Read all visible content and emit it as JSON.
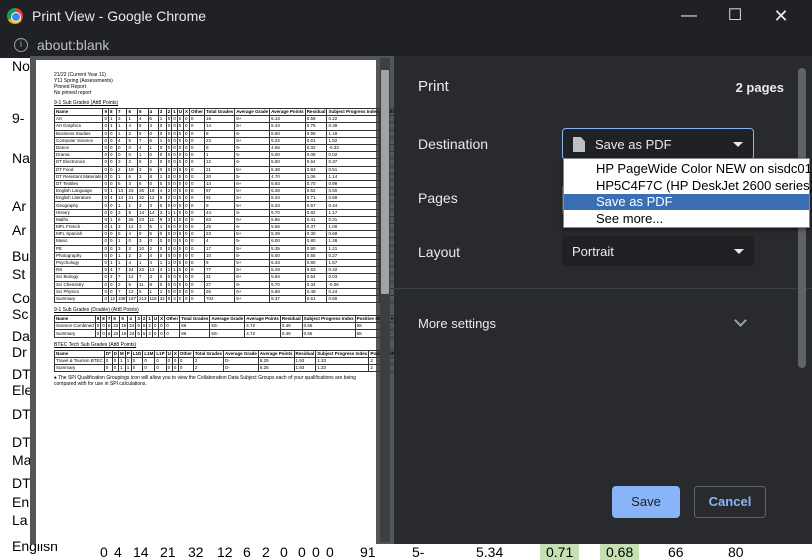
{
  "window": {
    "title": "Print View - Google Chrome",
    "url": "about:blank"
  },
  "background": {
    "lines": [
      "21",
      "Y1",
      "Pin",
      "No",
      "9-",
      "Na",
      "Ar",
      "Ar",
      "Bu",
      "St",
      "Co",
      "Sc",
      "Da",
      "Dr",
      "DT",
      "Ele",
      "DT",
      "DT",
      "Ma",
      "DT",
      "En",
      "La"
    ],
    "bottom_row": {
      "label": "English",
      "cells": [
        "0",
        "4",
        "14",
        "21",
        "32",
        "12",
        "6",
        "2",
        "0",
        "0",
        "0",
        "0",
        "91",
        "5-",
        "5.34",
        "0.71",
        "0.68",
        "66",
        "80"
      ]
    }
  },
  "print": {
    "title": "Print",
    "page_count": "2 pages",
    "destination_label": "Destination",
    "destination_value": "Save as PDF",
    "pages_label": "Pages",
    "layout_label": "Layout",
    "layout_value": "Portrait",
    "more_settings": "More settings",
    "save": "Save",
    "cancel": "Cancel"
  },
  "menu": {
    "items": [
      "HP PageWide Color NEW on sisdc01",
      "HP5C4F7C (HP DeskJet 2600 series)",
      "Save as PDF",
      "See more..."
    ],
    "selected_index": 2
  },
  "report": {
    "meta": [
      "21/22 (Current Year 11)",
      "Y11 Spring (Assessments)",
      "Pinned Report",
      "No pinned report"
    ],
    "table1": {
      "caption": "9-1 Sub Grades (Att8 Points)",
      "headers": [
        "Name",
        "9",
        "8",
        "7",
        "6",
        "5",
        "4",
        "3",
        "2",
        "1",
        "U",
        "X",
        "Other",
        "Total Grades",
        "Average Grade",
        "Average Points",
        "Residual",
        "Subject Progress Index",
        "Positive SPI",
        "In All Basket"
      ],
      "rows": [
        [
          "Art",
          "0",
          "1",
          "3",
          "1",
          "4",
          "6",
          "1",
          "0",
          "0",
          "0",
          "0",
          "0",
          "16",
          "5+",
          "5.13",
          "0.59",
          "0.22",
          "10",
          "15"
        ],
        [
          "Art Graphics",
          "0",
          "1",
          "1",
          "4",
          "5",
          "3",
          "0",
          "0",
          "0",
          "0",
          "0",
          "0",
          "14",
          "5+",
          "5.43",
          "0.75",
          "0.39",
          "11",
          "13"
        ],
        [
          "Business Studies",
          "0",
          "0",
          "1",
          "2",
          "5",
          "0",
          "0",
          "0",
          "0",
          "0",
          "0",
          "0",
          "8",
          "6-",
          "5.50",
          "0.95",
          "1.18",
          "6",
          "8"
        ],
        [
          "Computer Science",
          "0",
          "0",
          "4",
          "5",
          "7",
          "6",
          "1",
          "0",
          "0",
          "0",
          "0",
          "0",
          "23",
          "5+",
          "5.22",
          "0.61",
          "1.52",
          "20",
          "23"
        ],
        [
          "Dance",
          "0",
          "0",
          "0",
          "0",
          "4",
          "1",
          "0",
          "0",
          "0",
          "0",
          "0",
          "0",
          "9",
          "5-",
          "4.56",
          "0.32",
          "-0.33",
          "3",
          "8"
        ],
        [
          "Drama",
          "0",
          "0",
          "0",
          "0",
          "1",
          "0",
          "0",
          "0",
          "0",
          "0",
          "0",
          "0",
          "1",
          "5-",
          "5.00",
          "0.08",
          "0.02",
          "1",
          "1"
        ],
        [
          "DT Electronics",
          "0",
          "0",
          "3",
          "2",
          "5",
          "2",
          "0",
          "0",
          "0",
          "0",
          "0",
          "0",
          "12",
          "6-",
          "5.50",
          "0.64",
          "0.37",
          "6",
          "12"
        ],
        [
          "DT Food",
          "0",
          "0",
          "2",
          "10",
          "3",
          "6",
          "0",
          "0",
          "0",
          "0",
          "0",
          "0",
          "21",
          "5+",
          "5.38",
          "0.83",
          "0.51",
          "21",
          "21"
        ],
        [
          "DT Resistant Materials",
          "0",
          "0",
          "1",
          "6",
          "3",
          "8",
          "1",
          "0",
          "0",
          "0",
          "0",
          "0",
          "20",
          "5-",
          "4.70",
          "1.06",
          "1.14",
          "15",
          "20"
        ],
        [
          "DT Textiles",
          "0",
          "0",
          "5",
          "3",
          "6",
          "0",
          "0",
          "0",
          "0",
          "0",
          "0",
          "0",
          "14",
          "6+",
          "5.93",
          "0.70",
          "0.99",
          "12",
          "14"
        ],
        [
          "English Language",
          "0",
          "1",
          "13",
          "23",
          "26",
          "18",
          "4",
          "2",
          "0",
          "0",
          "0",
          "0",
          "87",
          "5+",
          "5.28",
          "0.62",
          "0.60",
          "60",
          "86"
        ],
        [
          "English Literature",
          "0",
          "4",
          "14",
          "21",
          "32",
          "12",
          "6",
          "2",
          "0",
          "0",
          "0",
          "0",
          "91",
          "5+",
          "5.34",
          "0.71",
          "0.68",
          "66",
          "89"
        ],
        [
          "Geography",
          "0",
          "0",
          "1",
          "1",
          "3",
          "3",
          "0",
          "0",
          "0",
          "0",
          "0",
          "0",
          "9",
          "5+",
          "5.33",
          "0.57",
          "0.44",
          "7",
          "9"
        ],
        [
          "History",
          "0",
          "0",
          "3",
          "8",
          "14",
          "14",
          "3",
          "1",
          "1",
          "0",
          "0",
          "0",
          "44",
          "5-",
          "5.70",
          "0.82",
          "1.17",
          "36",
          "44"
        ],
        [
          "Maths",
          "0",
          "1",
          "9",
          "26",
          "23",
          "11",
          "9",
          "3",
          "1",
          "0",
          "0",
          "0",
          "83",
          "5+",
          "5.86",
          "0.41",
          "0.31",
          "51",
          "83"
        ],
        [
          "MFL French",
          "0",
          "1",
          "3",
          "12",
          "3",
          "5",
          "1",
          "0",
          "0",
          "0",
          "0",
          "0",
          "25",
          "6-",
          "5.56",
          "0.37",
          "1.00",
          "20",
          "23"
        ],
        [
          "MFL Spanish",
          "0",
          "0",
          "5",
          "4",
          "9",
          "5",
          "0",
          "0",
          "0",
          "0",
          "0",
          "0",
          "23",
          "5+",
          "5.39",
          "0.30",
          "0.68",
          "17",
          "21"
        ],
        [
          "Music",
          "0",
          "0",
          "1",
          "0",
          "3",
          "0",
          "0",
          "0",
          "0",
          "0",
          "0",
          "0",
          "4",
          "5-",
          "6.00",
          "0.80",
          "1.48",
          "5",
          "5"
        ],
        [
          "PE",
          "0",
          "0",
          "3",
          "2",
          "10",
          "2",
          "0",
          "0",
          "0",
          "0",
          "0",
          "0",
          "17",
          "5+",
          "5.35",
          "0.90",
          "1.21",
          "16",
          "17"
        ],
        [
          "Photography",
          "0",
          "0",
          "1",
          "2",
          "3",
          "4",
          "0",
          "0",
          "0",
          "0",
          "0",
          "0",
          "10",
          "5-",
          "5.00",
          "0.55",
          "0.27",
          "5",
          "10"
        ],
        [
          "Psychology",
          "0",
          "1",
          "1",
          "4",
          "1",
          "4",
          "1",
          "1",
          "0",
          "0",
          "0",
          "0",
          "9",
          "5+",
          "5.33",
          "0.80",
          "1.57",
          "9",
          "8"
        ],
        [
          "RS",
          "0",
          "4",
          "7",
          "24",
          "23",
          "13",
          "4",
          "1",
          "1",
          "0",
          "0",
          "0",
          "77",
          "5+",
          "5.29",
          "0.63",
          "0.42",
          "43",
          "75"
        ],
        [
          "Sci Biology",
          "0",
          "2",
          "7",
          "12",
          "7",
          "3",
          "0",
          "0",
          "0",
          "0",
          "0",
          "0",
          "31",
          "6+",
          "5.94",
          "0.54",
          "0.03",
          "16",
          "31"
        ],
        [
          "Sci Chemistry",
          "0",
          "0",
          "2",
          "6",
          "11",
          "8",
          "0",
          "0",
          "0",
          "0",
          "0",
          "0",
          "27",
          "6-",
          "5.70",
          "0.34",
          "-0.06",
          "14",
          "27"
        ],
        [
          "Sci Physics",
          "0",
          "0",
          "7",
          "12",
          "5",
          "1",
          "1",
          "0",
          "0",
          "0",
          "0",
          "0",
          "26",
          "6+",
          "5.88",
          "0.49",
          "0.24",
          "14",
          "26"
        ],
        [
          "Summary",
          "0",
          "12",
          "108",
          "197",
          "213",
          "118",
          "32",
          "9",
          "3",
          "0",
          "0",
          "0",
          "702",
          "5+",
          "5.37",
          "0.61",
          "0.60",
          "475",
          "688"
        ]
      ]
    },
    "table2": {
      "caption": "9-1 Sub Grades (Double) (Att8 Points)",
      "headers": [
        "Name",
        "9",
        "8",
        "7",
        "6",
        "5",
        "4",
        "3",
        "2",
        "1",
        "U",
        "X",
        "Other",
        "Total Grades",
        "Average Grade",
        "Average Points",
        "Residual",
        "Subject Progress Index",
        "Positive SPI",
        "In All Basket"
      ],
      "rows": [
        [
          "Science Combined",
          "0",
          "0",
          "6",
          "22",
          "18",
          "24",
          "6",
          "6",
          "2",
          "0",
          "0",
          "0",
          "86",
          "5S-",
          "4.72",
          "0.49",
          "0.66",
          "58",
          "86"
        ],
        [
          "Summary",
          "0",
          "0",
          "6",
          "22",
          "18",
          "24",
          "6",
          "6",
          "2",
          "0",
          "0",
          "0",
          "86",
          "5S-",
          "4.72",
          "0.49",
          "0.66",
          "58",
          "86"
        ]
      ]
    },
    "table3": {
      "caption": "BTEC Tech Sub Grades (Att8 Points)",
      "headers": [
        "Name",
        "D*",
        "D",
        "M",
        "P",
        "L1D",
        "L1M",
        "L1P",
        "U",
        "X",
        "Other",
        "Total Grades",
        "Average Grade",
        "Average Points",
        "Residual",
        "Subject Progress Index",
        "Positive SPI",
        "In All Basket"
      ],
      "rows": [
        [
          "Travel & Tourism BTEC",
          "0",
          "0",
          "1",
          "1",
          "0",
          "0",
          "0",
          "0",
          "0",
          "0",
          "2",
          "D-",
          "6.25",
          "1.93",
          "1.33",
          "2",
          "2"
        ],
        [
          "Summary",
          "0",
          "0",
          "1",
          "1",
          "0",
          "0",
          "0",
          "0",
          "0",
          "0",
          "2",
          "D-",
          "6.25",
          "1.93",
          "1.33",
          "2",
          "2"
        ]
      ]
    },
    "footnote": "The SPI Qualification Groupings icon will allow you to view the Collaboration Data Subject Groups each of your qualifications are being compared with for use in SPI calculations."
  }
}
